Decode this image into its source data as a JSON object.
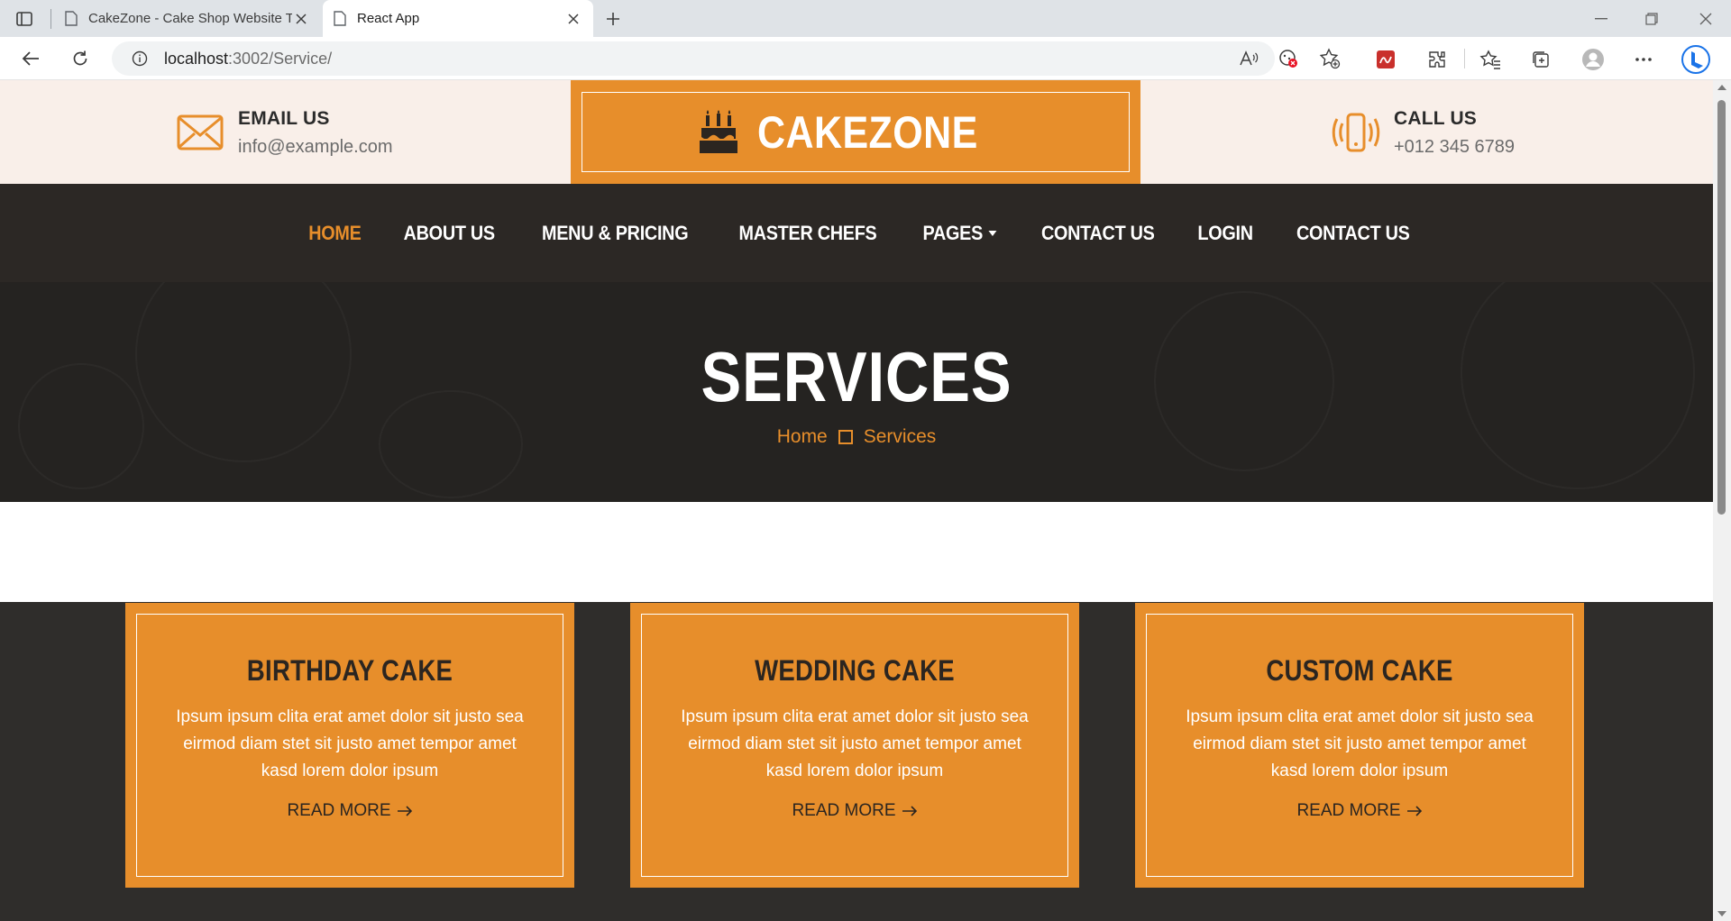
{
  "browser": {
    "tabs": [
      {
        "title": "CakeZone - Cake Shop Website T",
        "active": false
      },
      {
        "title": "React App",
        "active": true
      }
    ],
    "url_host": "localhost",
    "url_path": ":3002/Service/"
  },
  "topbar": {
    "email": {
      "label": "EMAIL US",
      "value": "info@example.com"
    },
    "phone": {
      "label": "CALL US",
      "value": "+012 345 6789"
    }
  },
  "brand": {
    "name": "CAKEZONE",
    "color": "#e78e2b"
  },
  "nav": {
    "items": [
      {
        "label": "HOME",
        "active": true
      },
      {
        "label": "ABOUT US"
      },
      {
        "label": "MENU & PRICING"
      },
      {
        "label": "MASTER CHEFS"
      },
      {
        "label": "PAGES",
        "dropdown": true
      },
      {
        "label": "CONTACT US"
      },
      {
        "label": "LOGIN"
      },
      {
        "label": "CONTACT US"
      }
    ]
  },
  "hero": {
    "title": "SERVICES",
    "breadcrumb": [
      "Home",
      "Services"
    ]
  },
  "services": [
    {
      "title": "BIRTHDAY CAKE",
      "desc": "Ipsum ipsum clita erat amet dolor sit justo sea eirmod diam stet sit justo amet tempor amet kasd lorem dolor ipsum",
      "link": "READ MORE"
    },
    {
      "title": "WEDDING CAKE",
      "desc": "Ipsum ipsum clita erat amet dolor sit justo sea eirmod diam stet sit justo amet tempor amet kasd lorem dolor ipsum",
      "link": "READ MORE"
    },
    {
      "title": "CUSTOM CAKE",
      "desc": "Ipsum ipsum clita erat amet dolor sit justo sea eirmod diam stet sit justo amet tempor amet kasd lorem dolor ipsum",
      "link": "READ MORE"
    }
  ]
}
